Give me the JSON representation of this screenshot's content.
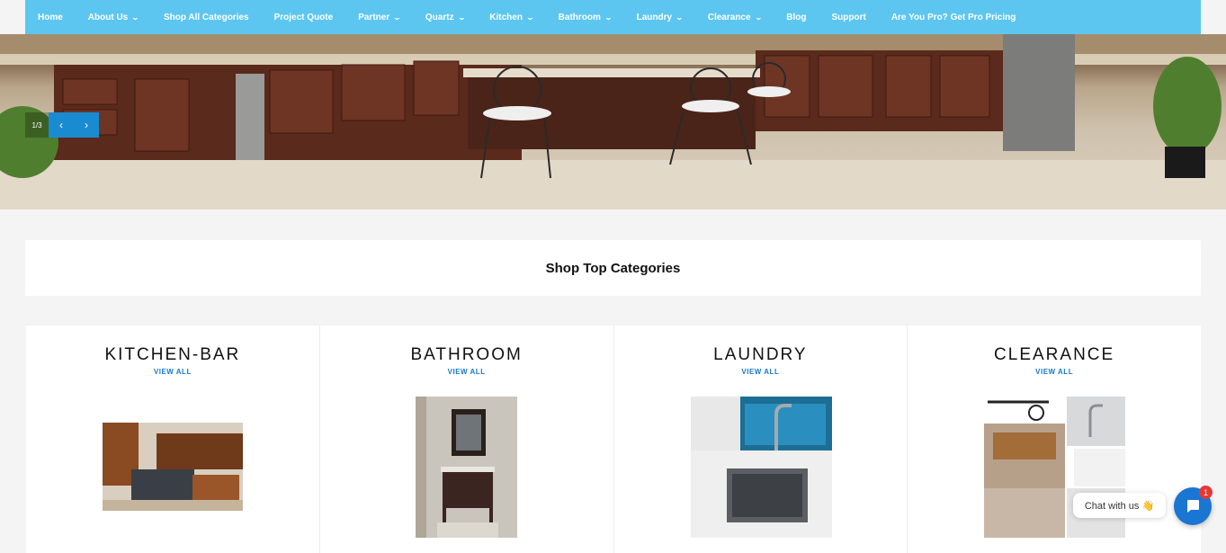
{
  "nav": {
    "items": [
      {
        "label": "Home",
        "dropdown": false
      },
      {
        "label": "About Us",
        "dropdown": true
      },
      {
        "label": "Shop All Categories",
        "dropdown": false
      },
      {
        "label": "Project Quote",
        "dropdown": false
      },
      {
        "label": "Partner",
        "dropdown": true
      },
      {
        "label": "Quartz",
        "dropdown": true
      },
      {
        "label": "Kitchen",
        "dropdown": true
      },
      {
        "label": "Bathroom",
        "dropdown": true
      },
      {
        "label": "Laundry",
        "dropdown": true
      },
      {
        "label": "Clearance",
        "dropdown": true
      },
      {
        "label": "Blog",
        "dropdown": false
      },
      {
        "label": "Support",
        "dropdown": false
      },
      {
        "label": "Are You Pro? Get Pro Pricing",
        "dropdown": false
      }
    ],
    "bg_color": "#5cc6f0"
  },
  "hero": {
    "slide_counter": "1/3",
    "prev_icon": "chevron-left-icon",
    "next_icon": "chevron-right-icon"
  },
  "section": {
    "title": "Shop Top Categories"
  },
  "categories": [
    {
      "title": "KITCHEN-BAR",
      "link": "VIEW ALL"
    },
    {
      "title": "BATHROOM",
      "link": "VIEW ALL"
    },
    {
      "title": "LAUNDRY",
      "link": "VIEW ALL"
    },
    {
      "title": "CLEARANCE",
      "link": "VIEW ALL"
    }
  ],
  "chat": {
    "label": "Chat with us 👋",
    "badge": "1",
    "icon": "chat-icon",
    "accent": "#1976d2"
  }
}
